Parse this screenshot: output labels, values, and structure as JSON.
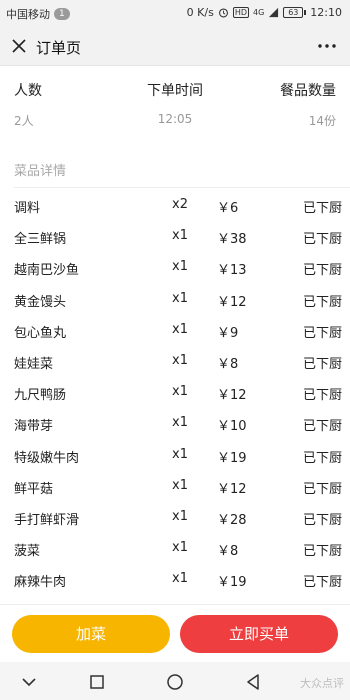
{
  "status_bar": {
    "carrier": "中国移动",
    "badge": "1",
    "speed": "0 K/s",
    "hd": "HD",
    "net": "4G",
    "battery": "63",
    "time": "12:10"
  },
  "header": {
    "title": "订单页"
  },
  "summary": {
    "people_label": "人数",
    "people_value": "2人",
    "time_label": "下单时间",
    "time_value": "12:05",
    "qty_label": "餐品数量",
    "qty_value": "14份"
  },
  "section_title": "菜品详情",
  "dishes": [
    {
      "name": "调料",
      "qty": "x2",
      "price": "￥6",
      "status": "已下厨"
    },
    {
      "name": "全三鲜锅",
      "qty": "x1",
      "price": "￥38",
      "status": "已下厨"
    },
    {
      "name": "越南巴沙鱼",
      "qty": "x1",
      "price": "￥13",
      "status": "已下厨"
    },
    {
      "name": "黄金馒头",
      "qty": "x1",
      "price": "￥12",
      "status": "已下厨"
    },
    {
      "name": "包心鱼丸",
      "qty": "x1",
      "price": "￥9",
      "status": "已下厨"
    },
    {
      "name": "娃娃菜",
      "qty": "x1",
      "price": "￥8",
      "status": "已下厨"
    },
    {
      "name": "九尺鸭肠",
      "qty": "x1",
      "price": "￥12",
      "status": "已下厨"
    },
    {
      "name": "海带芽",
      "qty": "x1",
      "price": "￥10",
      "status": "已下厨"
    },
    {
      "name": "特级嫩牛肉",
      "qty": "x1",
      "price": "￥19",
      "status": "已下厨"
    },
    {
      "name": "鲜平菇",
      "qty": "x1",
      "price": "￥12",
      "status": "已下厨"
    },
    {
      "name": "手打鲜虾滑",
      "qty": "x1",
      "price": "￥28",
      "status": "已下厨"
    },
    {
      "name": "菠菜",
      "qty": "x1",
      "price": "￥8",
      "status": "已下厨"
    },
    {
      "name": "麻辣牛肉",
      "qty": "x1",
      "price": "￥19",
      "status": "已下厨"
    }
  ],
  "actions": {
    "add_label": "加菜",
    "buy_label": "立即买单",
    "add_color": "#f7b500",
    "buy_color": "#ef3e3f"
  },
  "watermark": "大众点评"
}
